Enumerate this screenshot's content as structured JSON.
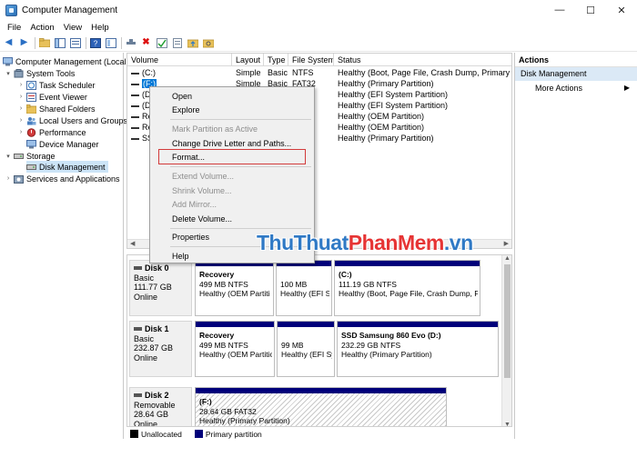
{
  "window": {
    "title": "Computer Management",
    "minimize": "—",
    "maximize": "☐",
    "close": "✕"
  },
  "menu": [
    "File",
    "Action",
    "View",
    "Help"
  ],
  "tree": {
    "root": "Computer Management (Local",
    "system_tools": "System Tools",
    "task_scheduler": "Task Scheduler",
    "event_viewer": "Event Viewer",
    "shared_folders": "Shared Folders",
    "local_users": "Local Users and Groups",
    "performance": "Performance",
    "device_manager": "Device Manager",
    "storage": "Storage",
    "disk_management": "Disk Management",
    "services": "Services and Applications"
  },
  "volume_table": {
    "columns": [
      "Volume",
      "Layout",
      "Type",
      "File System",
      "Status"
    ],
    "rows": [
      {
        "volume": "(C:)",
        "layout": "Simple",
        "type": "Basic",
        "fs": "NTFS",
        "status": "Healthy (Boot, Page File, Crash Dump, Primary Part"
      },
      {
        "volume": "(F:)",
        "layout": "Simple",
        "type": "Basic",
        "fs": "FAT32",
        "status": "Healthy (Primary Partition)"
      },
      {
        "volume": "(Di",
        "layout": "",
        "type": "",
        "fs": "",
        "status": "Healthy (EFI System Partition)"
      },
      {
        "volume": "(Di",
        "layout": "",
        "type": "",
        "fs": "",
        "status": "Healthy (EFI System Partition)"
      },
      {
        "volume": "Re",
        "layout": "",
        "type": "",
        "fs": "",
        "status": "Healthy (OEM Partition)"
      },
      {
        "volume": "Re",
        "layout": "",
        "type": "",
        "fs": "",
        "status": "Healthy (OEM Partition)"
      },
      {
        "volume": "SSI",
        "layout": "",
        "type": "",
        "fs": "",
        "status": "Healthy (Primary Partition)"
      }
    ]
  },
  "disks": [
    {
      "name": "Disk 0",
      "kind": "Basic",
      "size": "111.77 GB",
      "state": "Online",
      "partitions": [
        {
          "name": "Recovery",
          "size": "499 MB NTFS",
          "status": "Healthy (OEM Partiti"
        },
        {
          "name": "",
          "size": "100 MB",
          "status": "Healthy (EFI Sy"
        },
        {
          "name": "(C:)",
          "size": "111.19 GB NTFS",
          "status": "Healthy (Boot, Page File, Crash Dump, Pri"
        }
      ]
    },
    {
      "name": "Disk 1",
      "kind": "Basic",
      "size": "232.87 GB",
      "state": "Online",
      "partitions": [
        {
          "name": "Recovery",
          "size": "499 MB NTFS",
          "status": "Healthy (OEM Partitio"
        },
        {
          "name": "",
          "size": "99 MB",
          "status": "Healthy (EFI Sy"
        },
        {
          "name": "SSD Samsung 860 Evo  (D:)",
          "size": "232.29 GB NTFS",
          "status": "Healthy (Primary Partition)"
        }
      ]
    },
    {
      "name": "Disk 2",
      "kind": "Removable",
      "size": "28.64 GB",
      "state": "Online",
      "partitions": [
        {
          "name": "(F:)",
          "size": "28.64 GB FAT32",
          "status": "Healthy (Primary Partition)"
        }
      ]
    }
  ],
  "legend": {
    "unallocated": "Unallocated",
    "primary": "Primary partition"
  },
  "actions": {
    "header": "Actions",
    "selected": "Disk Management",
    "more": "More Actions",
    "more_arrow": "▶"
  },
  "context_menu": {
    "open": "Open",
    "explore": "Explore",
    "mark_active": "Mark Partition as Active",
    "change_letter": "Change Drive Letter and Paths...",
    "format": "Format...",
    "extend": "Extend Volume...",
    "shrink": "Shrink Volume...",
    "add_mirror": "Add Mirror...",
    "delete": "Delete Volume...",
    "properties": "Properties",
    "help": "Help"
  },
  "watermark": {
    "part1": "ThuThuat",
    "part2": "PhanMem",
    "part3": ".vn"
  },
  "colors": {
    "primary_partition": "#00007a",
    "highlight_box": "#d23a3a",
    "selection": "#cce4f7"
  }
}
